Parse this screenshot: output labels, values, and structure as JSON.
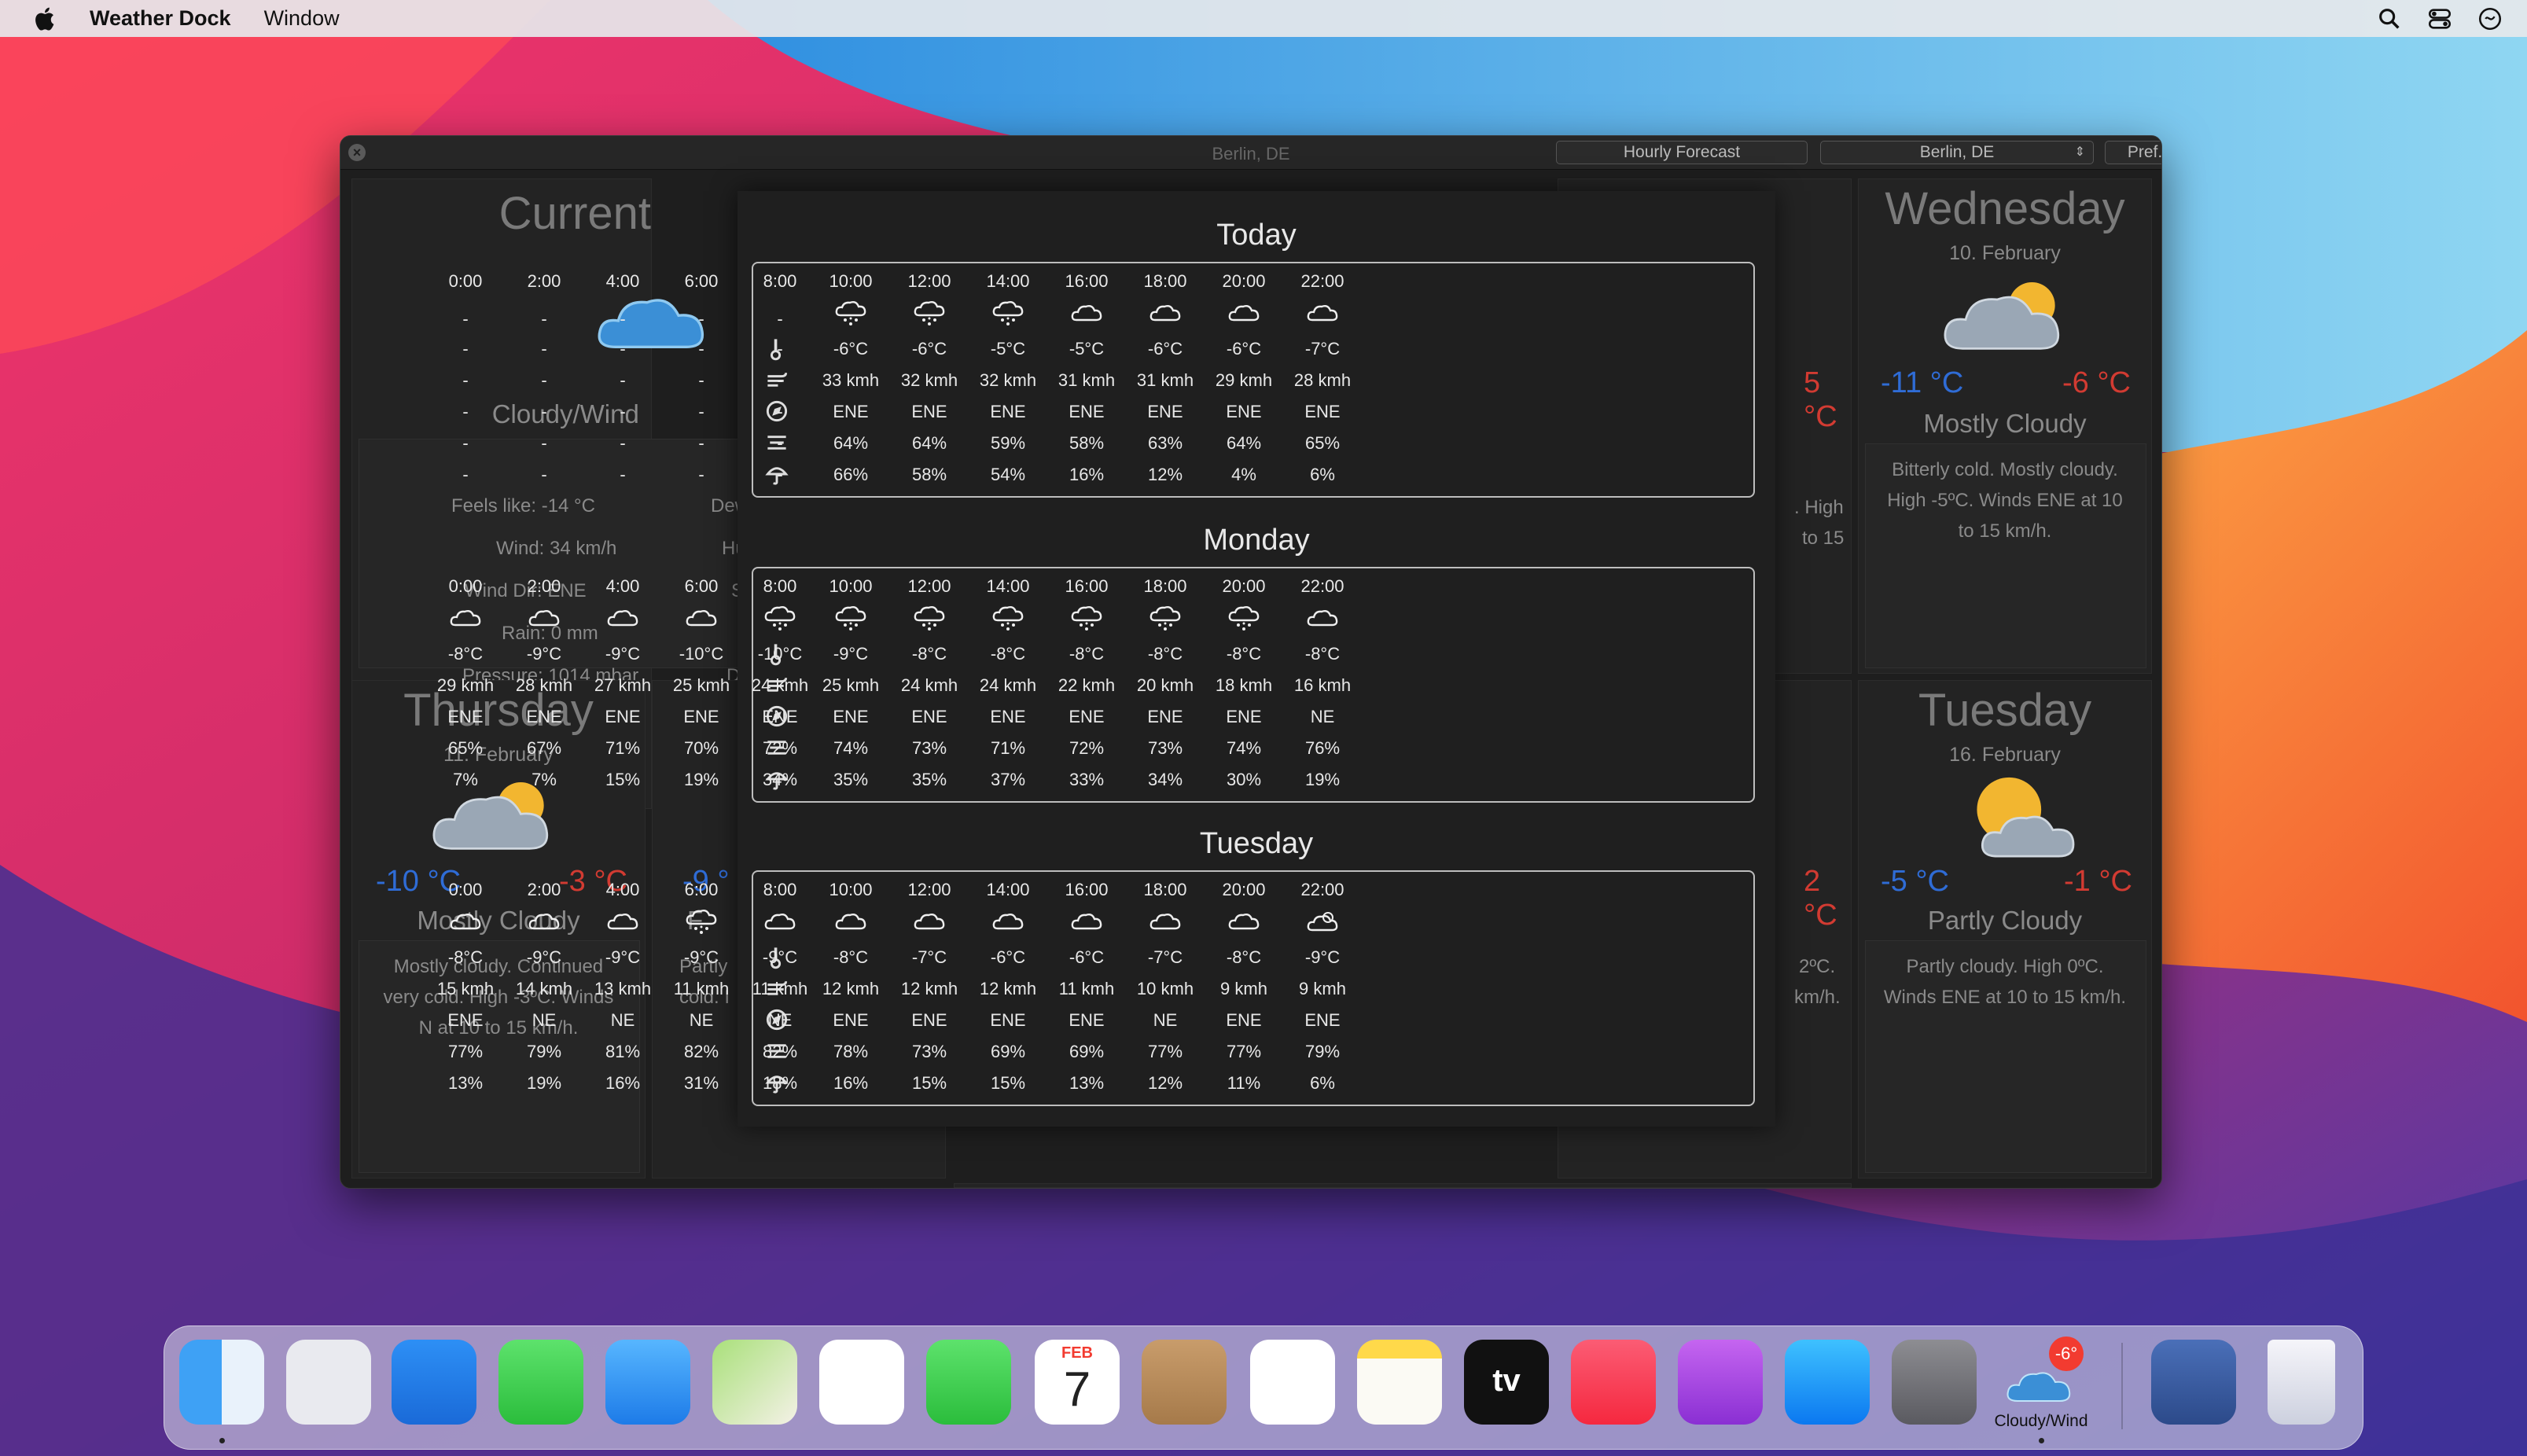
{
  "menubar": {
    "app_name": "Weather Dock",
    "menu_window": "Window"
  },
  "window": {
    "title": "Berlin, DE",
    "hourly_button": "Hourly Forecast",
    "city_select": "Berlin, DE",
    "pref_button": "Pref."
  },
  "current": {
    "heading": "Current",
    "condition": "Cloudy/Wind",
    "feels_like": "Feels like: -14 °C",
    "wind": "Wind: 34 km/h",
    "wind_dir": "Wind Dir: ENE",
    "rain": "Rain: 0 mm",
    "pressure": "Pressure: 1014 mbar",
    "dew_partial": "Dew",
    "hu_partial": "Hu",
    "s_partial": "S",
    "s2_partial": "S",
    "da_partial": "Da"
  },
  "cards": {
    "wednesday": {
      "day": "Wednesday",
      "date": "10. February",
      "low": "-11 °C",
      "high": "-6 °C",
      "condition": "Mostly Cloudy",
      "desc": "Bitterly cold. Mostly cloudy. High -5ºC. Winds ENE at 10 to 15 km/h."
    },
    "thursday": {
      "day": "Thursday",
      "date": "11. February",
      "low": "-10 °C",
      "high": "-3 °C",
      "condition": "Mostly Cloudy",
      "desc": "Mostly cloudy. Continued very cold. High -3ºC. Winds N at 10 to 15 km/h."
    },
    "tuesday": {
      "day": "Tuesday",
      "date": "16. February",
      "low": "-5 °C",
      "high": "-1 °C",
      "condition": "Partly Cloudy",
      "desc": "Partly cloudy. High 0ºC. Winds ENE at 10 to 15 km/h."
    },
    "partial": {
      "friday_low": "-9 °",
      "friday_cond": "F",
      "friday_desc1": "Partly",
      "friday_desc2": "cold. I",
      "right_high1": "5 °C",
      "right_high2": "2 °C",
      "right_text1": ". High",
      "right_text2": "to 15",
      "right_text3": "2ºC.",
      "right_text4": "km/h."
    }
  },
  "hourly": {
    "times": [
      "0:00",
      "2:00",
      "4:00",
      "6:00",
      "8:00",
      "10:00",
      "12:00",
      "14:00",
      "16:00",
      "18:00",
      "20:00",
      "22:00"
    ],
    "row_icons": [
      "thermometer-icon",
      "wind-icon",
      "compass-icon",
      "humidity-icon",
      "umbrella-icon"
    ],
    "days": [
      {
        "title": "Today",
        "conditions": [
          "-",
          "-",
          "-",
          "-",
          "-",
          "snow",
          "snow",
          "snow",
          "cloud",
          "cloud",
          "cloud",
          "cloud"
        ],
        "temp": [
          "-",
          "-",
          "-",
          "-",
          "-",
          "-6°C",
          "-6°C",
          "-5°C",
          "-5°C",
          "-6°C",
          "-6°C",
          "-7°C"
        ],
        "wind": [
          "-",
          "-",
          "-",
          "-",
          "-",
          "33 kmh",
          "32 kmh",
          "32 kmh",
          "31 kmh",
          "31 kmh",
          "29 kmh",
          "28 kmh"
        ],
        "dir": [
          "-",
          "-",
          "-",
          "-",
          "-",
          "ENE",
          "ENE",
          "ENE",
          "ENE",
          "ENE",
          "ENE",
          "ENE"
        ],
        "humidity": [
          "-",
          "-",
          "-",
          "-",
          "-",
          "64%",
          "64%",
          "59%",
          "58%",
          "63%",
          "64%",
          "65%"
        ],
        "precip": [
          "-",
          "-",
          "-",
          "-",
          "-",
          "66%",
          "58%",
          "54%",
          "16%",
          "12%",
          "4%",
          "6%"
        ]
      },
      {
        "title": "Monday",
        "conditions": [
          "cloud",
          "cloud",
          "cloud",
          "cloud",
          "snow",
          "snow",
          "snow",
          "snow",
          "snow",
          "snow",
          "snow",
          "cloud"
        ],
        "temp": [
          "-8°C",
          "-9°C",
          "-9°C",
          "-10°C",
          "-10°C",
          "-9°C",
          "-8°C",
          "-8°C",
          "-8°C",
          "-8°C",
          "-8°C",
          "-8°C"
        ],
        "wind": [
          "29 kmh",
          "28 kmh",
          "27 kmh",
          "25 kmh",
          "24 kmh",
          "25 kmh",
          "24 kmh",
          "24 kmh",
          "22 kmh",
          "20 kmh",
          "18 kmh",
          "16 kmh"
        ],
        "dir": [
          "ENE",
          "ENE",
          "ENE",
          "ENE",
          "ENE",
          "ENE",
          "ENE",
          "ENE",
          "ENE",
          "ENE",
          "ENE",
          "NE"
        ],
        "humidity": [
          "65%",
          "67%",
          "71%",
          "70%",
          "72%",
          "74%",
          "73%",
          "71%",
          "72%",
          "73%",
          "74%",
          "76%"
        ],
        "precip": [
          "7%",
          "7%",
          "15%",
          "19%",
          "34%",
          "35%",
          "35%",
          "37%",
          "33%",
          "34%",
          "30%",
          "19%"
        ]
      },
      {
        "title": "Tuesday",
        "conditions": [
          "cloud",
          "cloud",
          "cloud",
          "snow",
          "cloud",
          "cloud",
          "cloud",
          "cloud",
          "cloud",
          "cloud",
          "cloud",
          "partly"
        ],
        "temp": [
          "-8°C",
          "-9°C",
          "-9°C",
          "-9°C",
          "-9°C",
          "-8°C",
          "-7°C",
          "-6°C",
          "-6°C",
          "-7°C",
          "-8°C",
          "-9°C"
        ],
        "wind": [
          "15 kmh",
          "14 kmh",
          "13 kmh",
          "11 kmh",
          "11 kmh",
          "12 kmh",
          "12 kmh",
          "12 kmh",
          "11 kmh",
          "10 kmh",
          "9 kmh",
          "9 kmh"
        ],
        "dir": [
          "ENE",
          "NE",
          "NE",
          "NE",
          "NE",
          "ENE",
          "ENE",
          "ENE",
          "ENE",
          "NE",
          "ENE",
          "ENE"
        ],
        "humidity": [
          "77%",
          "79%",
          "81%",
          "82%",
          "82%",
          "78%",
          "73%",
          "69%",
          "69%",
          "77%",
          "77%",
          "79%"
        ],
        "precip": [
          "13%",
          "19%",
          "16%",
          "31%",
          "18%",
          "16%",
          "15%",
          "15%",
          "13%",
          "12%",
          "11%",
          "6%"
        ]
      }
    ]
  },
  "dock": {
    "apps": [
      "finder-icon",
      "launchpad-icon",
      "safari-icon",
      "messages-icon",
      "mail-icon",
      "maps-icon",
      "photos-icon",
      "facetime-icon",
      "calendar-icon",
      "contacts-icon",
      "reminders-icon",
      "notes-icon",
      "tv-icon",
      "music-icon",
      "podcasts-icon",
      "app-store-icon",
      "system-preferences-icon",
      "weather-dock-icon",
      "directory-utility-icon",
      "trash-icon"
    ],
    "calendar_month": "FEB",
    "calendar_day": "7",
    "tv_label": "tv",
    "weather_badge": "-6°",
    "weather_label": "Cloudy/Wind"
  },
  "colors": {
    "low_temp": "#2f6cd6",
    "high_temp": "#d23b32",
    "window_bg": "#1e1e1e"
  }
}
